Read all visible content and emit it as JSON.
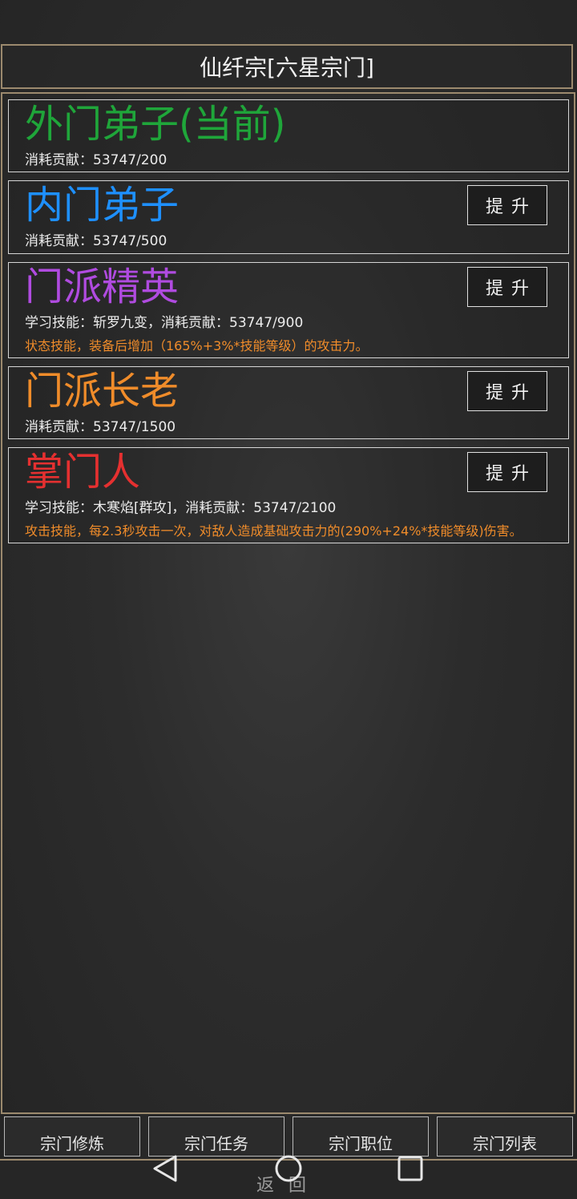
{
  "header": {
    "title": "仙纤宗[六星宗门]"
  },
  "ranks": [
    {
      "name": "外门弟子(当前)",
      "color": "#1fa63a",
      "cost": "消耗贡献：53747/200"
    },
    {
      "name": "内门弟子",
      "color": "#1e90ff",
      "cost": "消耗贡献：53747/500",
      "button": "提升"
    },
    {
      "name": "门派精英",
      "color": "#b04be0",
      "cost": "学习技能：斩罗九变，消耗贡献：53747/900",
      "desc": "状态技能，装备后增加（165%+3%*技能等级）的攻击力。",
      "button": "提升"
    },
    {
      "name": "门派长老",
      "color": "#f08c2a",
      "cost": "消耗贡献：53747/1500",
      "button": "提升"
    },
    {
      "name": "掌门人",
      "color": "#e53030",
      "cost": "学习技能：木寒焰[群攻]，消耗贡献：53747/2100",
      "desc": "攻击技能，每2.3秒攻击一次，对敌人造成基础攻击力的(290%+24%*技能等级)伤害。",
      "button": "提升"
    }
  ],
  "tabs": [
    "宗门修炼",
    "宗门任务",
    "宗门职位",
    "宗门列表"
  ],
  "footer": {
    "back_label": "返回"
  },
  "colors": {
    "border": "#9c8a6e",
    "desc": "#f08c2a"
  }
}
